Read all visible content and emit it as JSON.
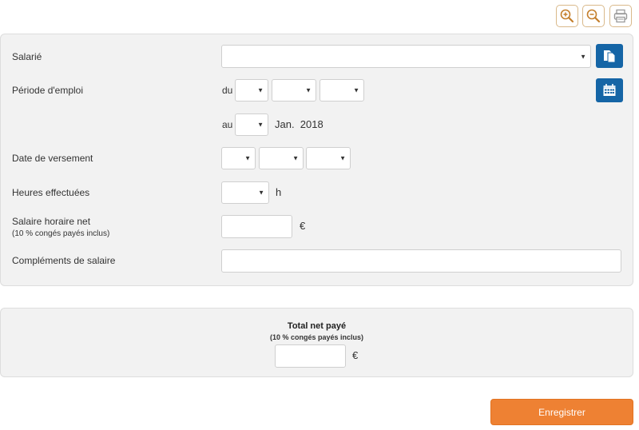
{
  "toolbar": {
    "zoom_in_icon": "zoom-in-icon",
    "zoom_out_icon": "zoom-out-icon",
    "print_icon": "print-icon"
  },
  "form": {
    "employee_label": "Salarié",
    "employee_value": "",
    "employment_period_label": "Période d'emploi",
    "from_label": "du",
    "to_label": "au",
    "to_month_year": "Jan.  2018",
    "payment_date_label": "Date de versement",
    "hours_worked_label": "Heures effectuées",
    "hours_unit": "h",
    "hourly_wage_label": "Salaire horaire net",
    "hourly_wage_sublabel": "(10 % congés payés inclus)",
    "currency_unit": "€",
    "hourly_wage_value": "",
    "salary_supplements_label": "Compléments de salaire",
    "salary_supplements_value": ""
  },
  "total": {
    "title": "Total net payé",
    "sublabel": "(10 % congés payés inclus)",
    "value": "",
    "currency_unit": "€"
  },
  "actions": {
    "save_label": "Enregistrer"
  },
  "colors": {
    "accent_orange": "#ee8133",
    "icon_blue": "#1565a6",
    "toolbar_border": "#d9b98a",
    "panel_bg": "#f2f2f2"
  }
}
